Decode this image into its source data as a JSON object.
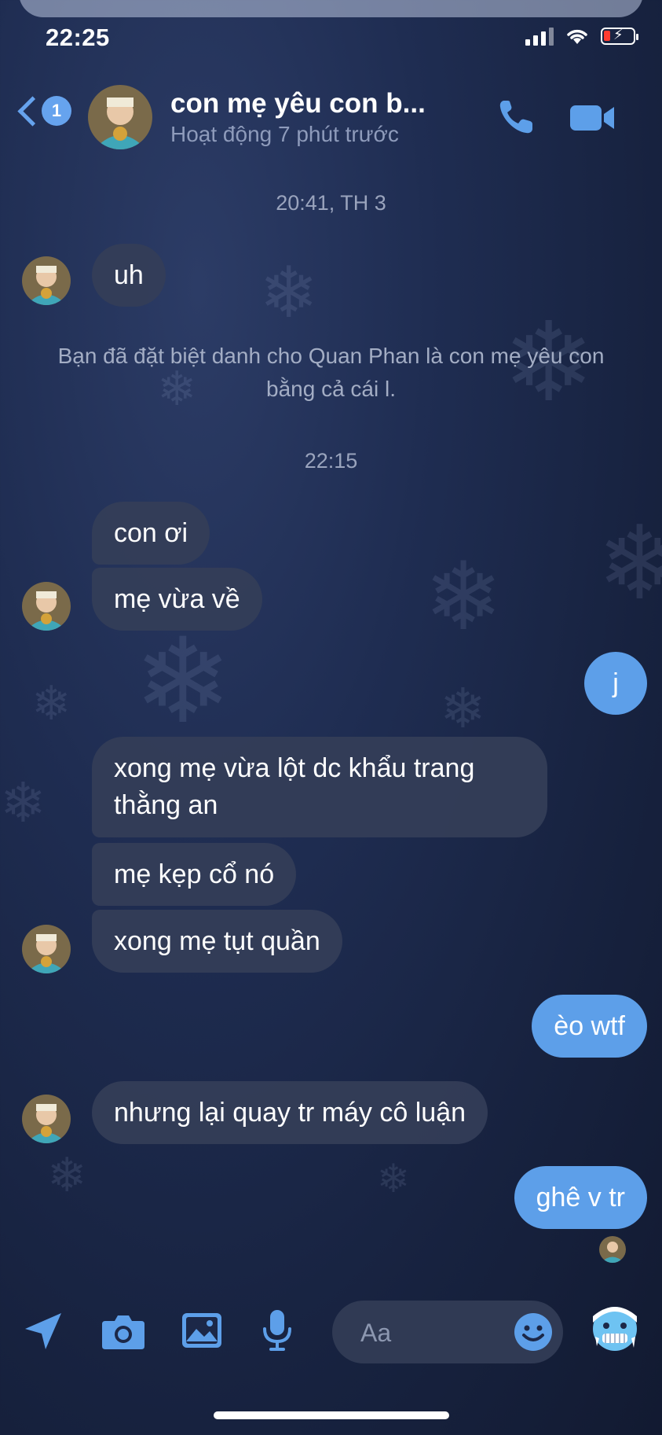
{
  "status_bar": {
    "time": "22:25"
  },
  "header": {
    "unread_count": "1",
    "title": "con mẹ yêu con b...",
    "subtitle": "Hoạt động 7 phút trước"
  },
  "messages": {
    "ts1": "20:41, TH 3",
    "m1": "uh",
    "system_line1": "Bạn đã đặt biệt danh cho Quan Phan là con mẹ yêu con",
    "system_line2": "bằng cả cái l.",
    "ts2": "22:15",
    "m2": "con ơi",
    "m3": "mẹ vừa về",
    "m4": "j",
    "m5_line1": "xong mẹ vừa lột dc khẩu trang",
    "m5_line2": "thằng an",
    "m6": "mẹ kẹp cổ nó",
    "m7": "xong mẹ tụt quần",
    "m8": "èo wtf",
    "m9": "nhưng lại quay tr máy cô luận",
    "m10": "ghê v tr"
  },
  "composer": {
    "placeholder": "Aa"
  },
  "colors": {
    "accent": "#5d9fe9",
    "incoming_bubble": "#343e58",
    "background": "#1f2d52"
  }
}
